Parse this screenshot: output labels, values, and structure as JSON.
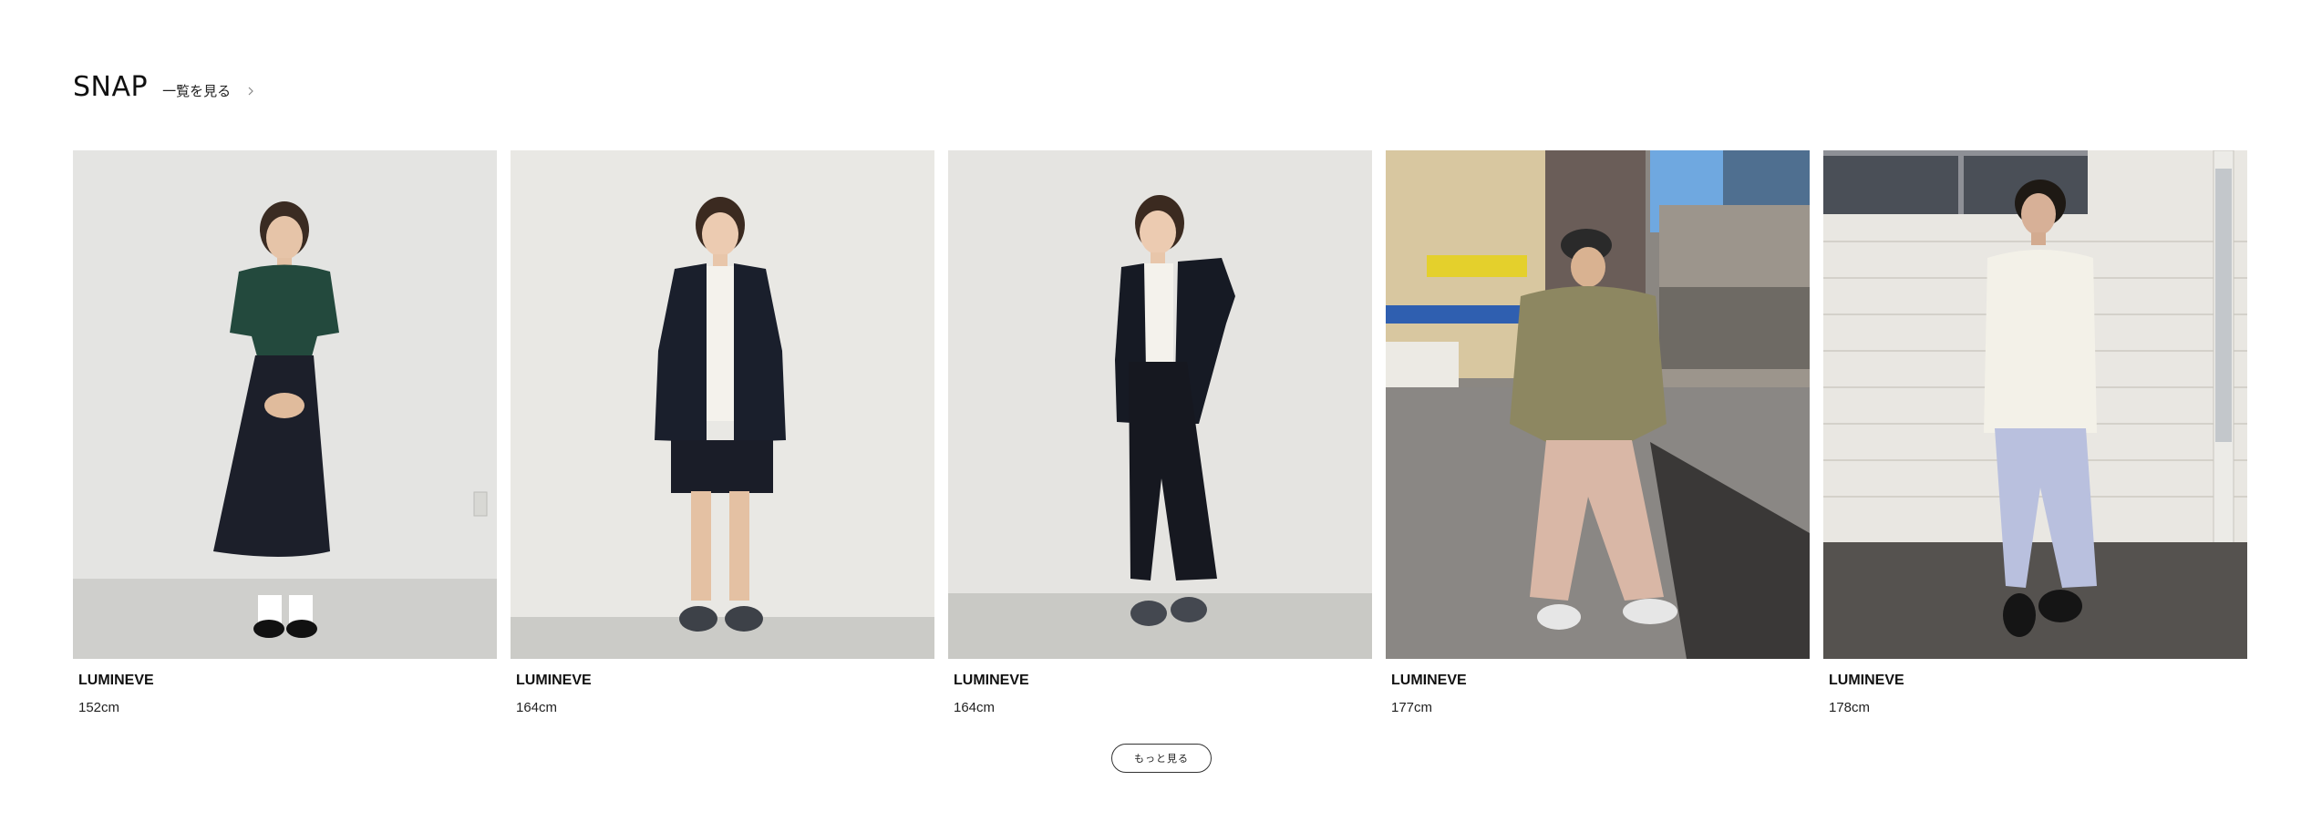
{
  "section": {
    "title": "SNAP",
    "view_all_label": "一覧を見る"
  },
  "cards": [
    {
      "brand": "LUMINEVE",
      "height": "152cm"
    },
    {
      "brand": "LUMINEVE",
      "height": "164cm"
    },
    {
      "brand": "LUMINEVE",
      "height": "164cm"
    },
    {
      "brand": "LUMINEVE",
      "height": "177cm"
    },
    {
      "brand": "LUMINEVE",
      "height": "178cm"
    }
  ],
  "more_button": {
    "label": "もっと見る"
  },
  "icons": {
    "view_all": "chevron-right-icon"
  },
  "colors": {
    "text": "#111111",
    "border": "#333333",
    "background": "#ffffff"
  }
}
